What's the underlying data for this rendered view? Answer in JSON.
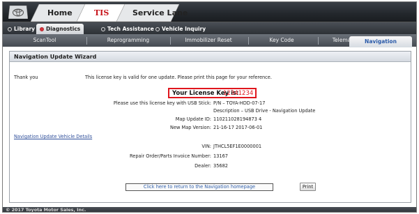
{
  "top_tabs": [
    {
      "label": "Home",
      "active": false
    },
    {
      "label": "TIS",
      "active": true
    },
    {
      "label": "Service Lane",
      "active": false
    }
  ],
  "nav_tabs": [
    {
      "label": "Library",
      "active": false
    },
    {
      "label": "Diagnostics",
      "active": true
    },
    {
      "label": "Tech Assistance",
      "active": false
    },
    {
      "label": "Vehicle Inquiry",
      "active": false
    }
  ],
  "sub_tabs": [
    {
      "label": "ScanTool",
      "active": false
    },
    {
      "label": "Reprogramming",
      "active": false
    },
    {
      "label": "Immobilizer Reset",
      "active": false
    },
    {
      "label": "Key Code",
      "active": false
    },
    {
      "label": "Telematics",
      "active": false
    },
    {
      "label": "Navigation",
      "active": true
    }
  ],
  "wizard": {
    "title": "Navigation Update Wizard",
    "thank_you": "Thank you",
    "valid_note": "This license key is valid for one update. Please print this page for your reference.",
    "license_label": "Your License Key is:",
    "license_value": "12341234",
    "usb_label": "Please use this license key with USB Stick:",
    "usb_value": "P/N – TOYA-HDD-07-17",
    "description_value": "Description – USB Drive - Navigation Update",
    "map_update_label": "Map Update ID:",
    "map_update_value": "110211028194873 4",
    "new_map_label": "New Map Version:",
    "new_map_value": "21-16-17 2017-06-01",
    "vehicle_details_link": "Navigation Update Vehicle Details",
    "vin_label": "VIN:",
    "vin_value": "JTHCL5EF1E0000001",
    "repair_label": "Repair Order/Parts Invoice Number:",
    "repair_value": "13167",
    "dealer_label": "Dealer:",
    "dealer_value": "35682",
    "return_button": "Click here to return to the Navigation homepage",
    "print_button": "Print"
  },
  "footer": {
    "copyright": "© 2017 Toyota Motor Sales, Inc."
  },
  "colors": {
    "accent_red": "#e0161d",
    "link_blue": "#2f5ea8",
    "bar_dark": "#23272c"
  }
}
